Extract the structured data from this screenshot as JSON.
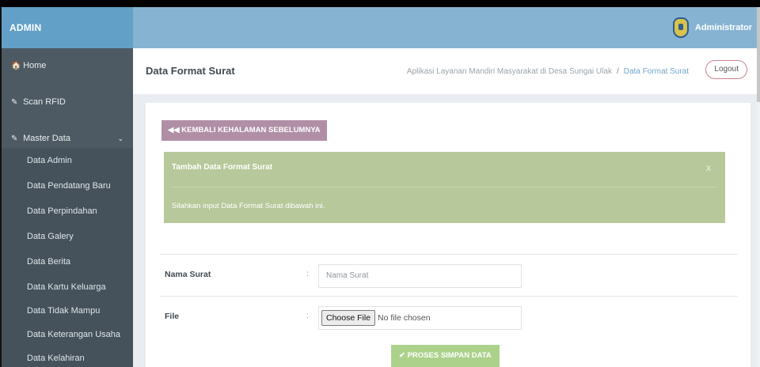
{
  "app": {
    "brand": "ADMIN",
    "user_name": "Administrator"
  },
  "sidebar": {
    "items": [
      {
        "label": "Home",
        "icon": "home-icon",
        "glyph": "🏠"
      },
      {
        "label": "Scan RFID",
        "icon": "edit-icon",
        "glyph": "✎"
      },
      {
        "label": "Master Data",
        "icon": "edit-icon",
        "glyph": "✎",
        "chevron": "⌄"
      }
    ],
    "sub_items": [
      "Data Admin",
      "Data Pendatang Baru",
      "Data Perpindahan",
      "Data Galery",
      "Data Berita",
      "Data Kartu Keluarga",
      "Data Tidak Mampu",
      "Data Keterangan Usaha",
      "Data Kelahiran"
    ]
  },
  "header": {
    "title": "Data Format Surat",
    "breadcrumb": {
      "root": "Aplikasi Layanan Mandiri Masyarakat di Desa Sungai Ulak",
      "separator": "/",
      "current": "Data Format Surat"
    },
    "logout_label": "Logout"
  },
  "panel": {
    "back_label": "◀◀ KEMBALI KEHALAMAN SEBELUMNYA",
    "alert": {
      "title": "Tambah Data Format Surat",
      "close": "x",
      "message": "Silahkan input Data Format Surat dibawah ini."
    },
    "form": {
      "nama_label": "Nama Surat",
      "nama_placeholder": "Nama Surat",
      "file_label": "File",
      "colon": ":",
      "file_button": "Choose File",
      "file_status": "No file chosen",
      "submit_label": "✔ PROSES SIMPAN DATA"
    }
  },
  "colors": {
    "topbar": "#87b3d2",
    "brand": "#63a0c7",
    "sidebar": "#4d5a63",
    "back_button": "#b08fa6",
    "alert": "#b7c89a",
    "submit_button": "#acd18b"
  }
}
